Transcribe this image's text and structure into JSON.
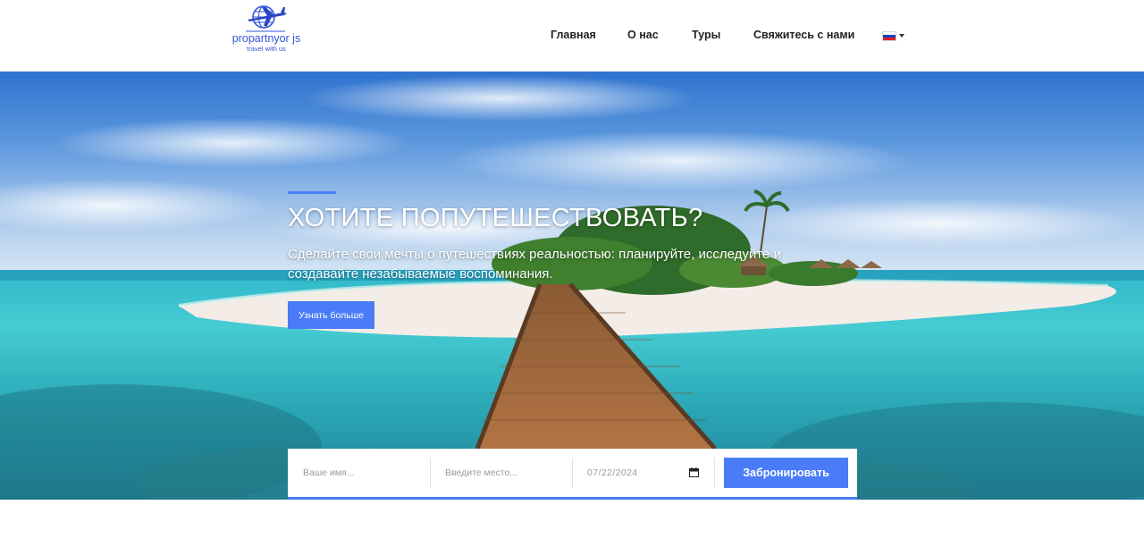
{
  "brand": {
    "name": "propartnyor js",
    "tagline": "travel with us",
    "icon": "airplane-globe-icon",
    "color": "#3556d6"
  },
  "nav": {
    "items": [
      {
        "label": "Главная"
      },
      {
        "label": "О нас"
      },
      {
        "label": "Туры"
      },
      {
        "label": "Свяжитесь с нами"
      }
    ],
    "language": {
      "icon": "russia-flag-icon",
      "dropdown_icon": "caret-down-icon"
    }
  },
  "hero": {
    "title": "ХОТИТЕ ПОПУТЕШЕСТВОВАТЬ?",
    "subtitle": "Сделайте свои мечты о путешествиях реальностью: планируйте, исследуйте и создавайте незабываемые воспоминания.",
    "cta_label": "Узнать больше",
    "background": "tropical-island-pier-photo"
  },
  "booking": {
    "name_placeholder": "Ваше имя...",
    "place_placeholder": "Введите место...",
    "date_value": "07/22/2024",
    "calendar_icon": "calendar-icon",
    "submit_label": "Забронировать"
  },
  "colors": {
    "accent": "#4a7cf7",
    "text": "#222222"
  }
}
